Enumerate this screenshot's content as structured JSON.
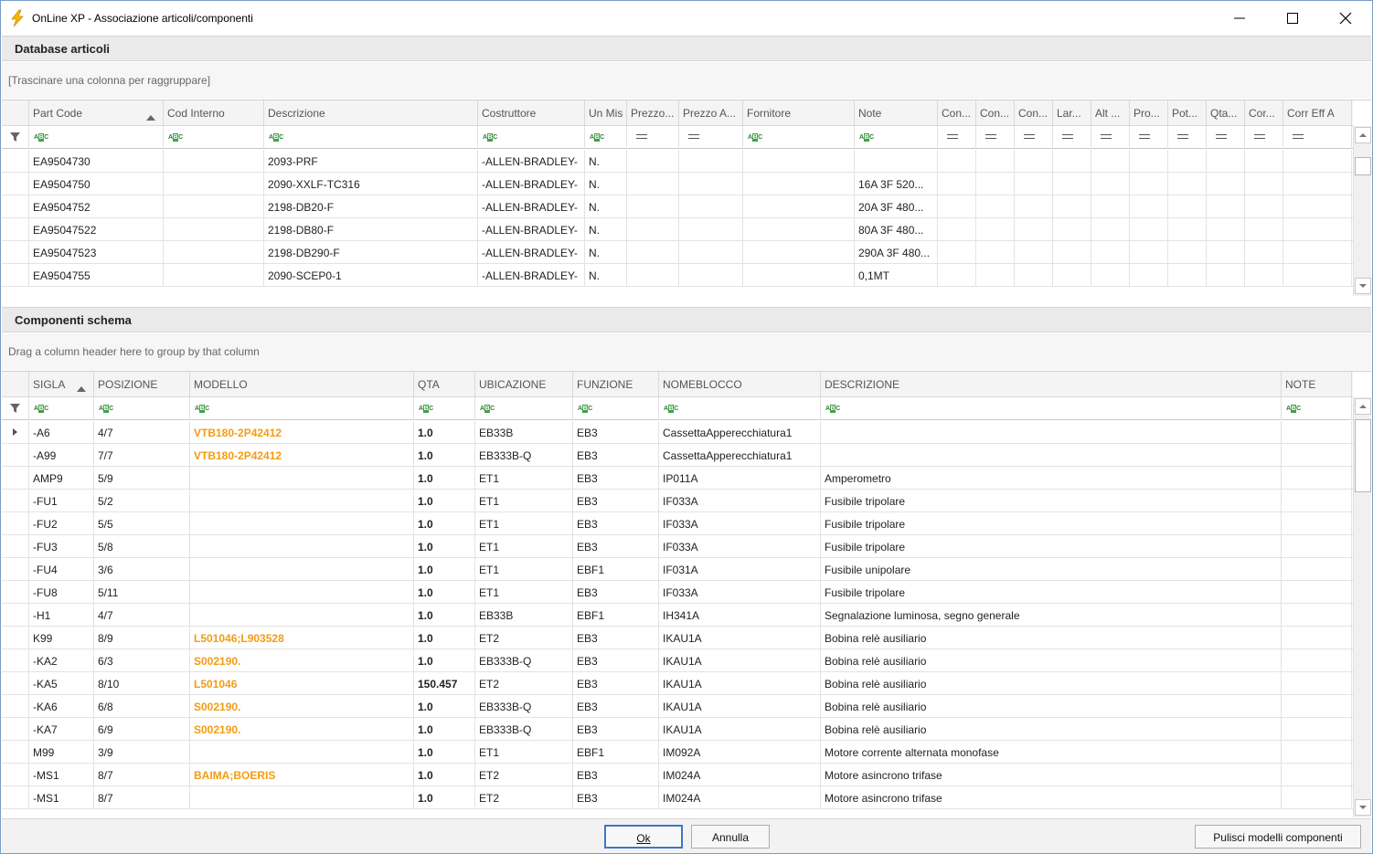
{
  "window": {
    "title": "OnLine XP - Associazione articoli/componenti",
    "icon": "lightning-icon",
    "accent_color": "#f5b800"
  },
  "articles": {
    "header": "Database articoli",
    "group_hint": "[Trascinare una colonna per raggruppare]",
    "columns": [
      {
        "label": "Part Code",
        "filter": "abc",
        "sorted": true
      },
      {
        "label": "Cod Interno",
        "filter": "abc"
      },
      {
        "label": "Descrizione",
        "filter": "abc"
      },
      {
        "label": "Costruttore",
        "filter": "abc"
      },
      {
        "label": "Un Mis",
        "filter": "abc"
      },
      {
        "label": "Prezzo...",
        "filter": "eq"
      },
      {
        "label": "Prezzo A...",
        "filter": "eq"
      },
      {
        "label": "Fornitore",
        "filter": "abc"
      },
      {
        "label": "Note",
        "filter": "abc"
      },
      {
        "label": "Con...",
        "filter": "eq"
      },
      {
        "label": "Con...",
        "filter": "eq"
      },
      {
        "label": "Con...",
        "filter": "eq"
      },
      {
        "label": "Lar...",
        "filter": "eq"
      },
      {
        "label": "Alt ...",
        "filter": "eq"
      },
      {
        "label": "Pro...",
        "filter": "eq"
      },
      {
        "label": "Pot...",
        "filter": "eq"
      },
      {
        "label": "Qta...",
        "filter": "eq"
      },
      {
        "label": "Cor...",
        "filter": "eq"
      },
      {
        "label": "Corr Eff A",
        "filter": "eq"
      }
    ],
    "rows": [
      [
        "EA9504730",
        "",
        "2093-PRF",
        "-ALLEN-BRADLEY-",
        "N.",
        "",
        "",
        "",
        "",
        "",
        "",
        "",
        "",
        "",
        "",
        "",
        "",
        "",
        ""
      ],
      [
        "EA9504750",
        "",
        "2090-XXLF-TC316",
        "-ALLEN-BRADLEY-",
        "N.",
        "",
        "",
        "",
        "16A 3F 520...",
        "",
        "",
        "",
        "",
        "",
        "",
        "",
        "",
        "",
        ""
      ],
      [
        "EA9504752",
        "",
        "2198-DB20-F",
        "-ALLEN-BRADLEY-",
        "N.",
        "",
        "",
        "",
        "20A 3F 480...",
        "",
        "",
        "",
        "",
        "",
        "",
        "",
        "",
        "",
        ""
      ],
      [
        "EA95047522",
        "",
        "2198-DB80-F",
        "-ALLEN-BRADLEY-",
        "N.",
        "",
        "",
        "",
        "80A 3F 480...",
        "",
        "",
        "",
        "",
        "",
        "",
        "",
        "",
        "",
        ""
      ],
      [
        "EA95047523",
        "",
        "2198-DB290-F",
        "-ALLEN-BRADLEY-",
        "N.",
        "",
        "",
        "",
        "290A 3F 480...",
        "",
        "",
        "",
        "",
        "",
        "",
        "",
        "",
        "",
        ""
      ],
      [
        "EA9504755",
        "",
        "2090-SCEP0-1",
        "-ALLEN-BRADLEY-",
        "N.",
        "",
        "",
        "",
        "0,1MT",
        "",
        "",
        "",
        "",
        "",
        "",
        "",
        "",
        "",
        ""
      ]
    ]
  },
  "components": {
    "header": "Componenti schema",
    "group_hint": "Drag a column header here to group by that column",
    "columns": [
      {
        "label": "SIGLA",
        "sorted": true
      },
      {
        "label": "POSIZIONE"
      },
      {
        "label": "MODELLO"
      },
      {
        "label": "QTA"
      },
      {
        "label": "UBICAZIONE"
      },
      {
        "label": "FUNZIONE"
      },
      {
        "label": "NOMEBLOCCO"
      },
      {
        "label": "DESCRIZIONE"
      },
      {
        "label": "NOTE"
      }
    ],
    "rows": [
      [
        "-A6",
        "4/7",
        "VTB180-2P42412",
        "1.0",
        "EB33B",
        "EB3",
        "CassettaApperecchiatura1",
        "",
        ""
      ],
      [
        "-A99",
        "7/7",
        "VTB180-2P42412",
        "1.0",
        "EB333B-Q",
        "EB3",
        "CassettaApperecchiatura1",
        "",
        ""
      ],
      [
        "AMP9",
        "5/9",
        "",
        "1.0",
        "ET1",
        "EB3",
        "IP011A",
        "Amperometro",
        ""
      ],
      [
        "-FU1",
        "5/2",
        "",
        "1.0",
        "ET1",
        "EB3",
        "IF033A",
        "Fusibile tripolare",
        ""
      ],
      [
        "-FU2",
        "5/5",
        "",
        "1.0",
        "ET1",
        "EB3",
        "IF033A",
        "Fusibile tripolare",
        ""
      ],
      [
        "-FU3",
        "5/8",
        "",
        "1.0",
        "ET1",
        "EB3",
        "IF033A",
        "Fusibile tripolare",
        ""
      ],
      [
        "-FU4",
        "3/6",
        "",
        "1.0",
        "ET1",
        "EBF1",
        "IF031A",
        "Fusibile unipolare",
        ""
      ],
      [
        "-FU8",
        "5/11",
        "",
        "1.0",
        "ET1",
        "EB3",
        "IF033A",
        "Fusibile tripolare",
        ""
      ],
      [
        "-H1",
        "4/7",
        "",
        "1.0",
        "EB33B",
        "EBF1",
        "IH341A",
        "Segnalazione luminosa, segno generale",
        ""
      ],
      [
        "K99",
        "8/9",
        "L501046;L903528",
        "1.0",
        "ET2",
        "EB3",
        "IKAU1A",
        "Bobina relè ausiliario",
        ""
      ],
      [
        "-KA2",
        "6/3",
        "S002190.",
        "1.0",
        "EB333B-Q",
        "EB3",
        "IKAU1A",
        "Bobina relè ausiliario",
        ""
      ],
      [
        "-KA5",
        "8/10",
        "L501046",
        "150.457",
        "ET2",
        "EB3",
        "IKAU1A",
        "Bobina relè ausiliario",
        ""
      ],
      [
        "-KA6",
        "6/8",
        "S002190.",
        "1.0",
        "EB333B-Q",
        "EB3",
        "IKAU1A",
        "Bobina relè ausiliario",
        ""
      ],
      [
        "-KA7",
        "6/9",
        "S002190.",
        "1.0",
        "EB333B-Q",
        "EB3",
        "IKAU1A",
        "Bobina relè ausiliario",
        ""
      ],
      [
        "M99",
        "3/9",
        "",
        "1.0",
        "ET1",
        "EBF1",
        "IM092A",
        "Motore corrente alternata monofase",
        ""
      ],
      [
        "-MS1",
        "8/7",
        "BAIMA;BOERIS",
        "1.0",
        "ET2",
        "EB3",
        "IM024A",
        "Motore asincrono trifase",
        ""
      ],
      [
        "-MS1",
        "8/7",
        "",
        "1.0",
        "ET2",
        "EB3",
        "IM024A",
        "Motore asincrono trifase",
        ""
      ]
    ],
    "model_color": "#f39c12"
  },
  "footer": {
    "ok_label": "Ok",
    "cancel_label": "Annulla",
    "clear_label": "Pulisci modelli componenti"
  }
}
